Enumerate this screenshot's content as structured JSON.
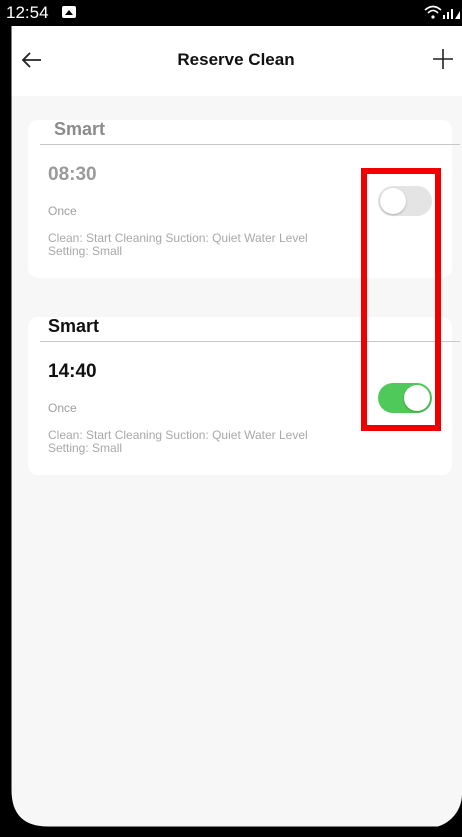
{
  "status_bar": {
    "time": "12:54",
    "icons": [
      "gallery-icon",
      "wifi-icon",
      "signal-icon"
    ]
  },
  "appbar": {
    "title": "Reserve Clean",
    "back_icon": "arrow-left-icon",
    "add_icon": "plus-icon"
  },
  "schedules": [
    {
      "title": "Smart",
      "time": "08:30",
      "repeat": "Once",
      "detail": "Clean: Start Cleaning  Suction: Quiet  Water Level Setting: Small",
      "enabled": false
    },
    {
      "title": "Smart",
      "time": "14:40",
      "repeat": "Once",
      "detail": "Clean: Start Cleaning  Suction: Quiet  Water Level Setting: Small",
      "enabled": true
    }
  ],
  "colors": {
    "toggle_on": "#4fca5a",
    "toggle_off": "#e4e4e4",
    "highlight": "#f20000",
    "background": "#f7f7f7"
  }
}
